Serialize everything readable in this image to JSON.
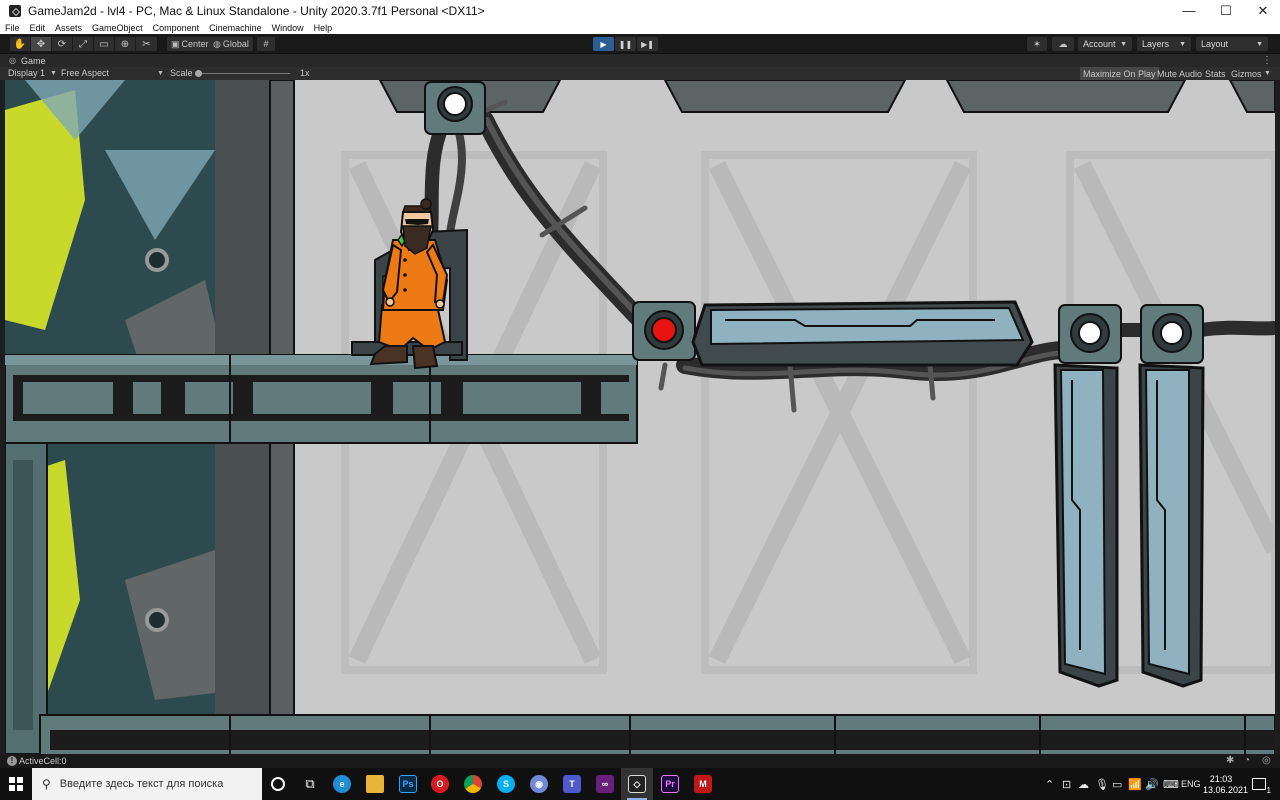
{
  "window": {
    "title": "GameJam2d - lvl4 - PC, Mac & Linux Standalone - Unity 2020.3.7f1 Personal <DX11>",
    "minimize": "—",
    "maximize": "☐",
    "close": "✕"
  },
  "menu": [
    "File",
    "Edit",
    "Assets",
    "GameObject",
    "Component",
    "Cinemachine",
    "Window",
    "Help"
  ],
  "toolbar": {
    "pivot_label": "Center",
    "space_label": "Global",
    "account_label": "Account",
    "layers_label": "Layers",
    "layout_label": "Layout"
  },
  "game_tab": {
    "label": "Game"
  },
  "game_bar": {
    "display": "Display 1",
    "aspect": "Free Aspect",
    "scale_label": "Scale",
    "scale_value": "1x",
    "maximize_on_play": "Maximize On Play",
    "mute_audio": "Mute Audio",
    "stats": "Stats",
    "gizmos": "Gizmos"
  },
  "status": {
    "text": "ActiveCell:0"
  },
  "taskbar": {
    "search_placeholder": "Введите здесь текст для поиска",
    "language": "ENG",
    "time": "21:03",
    "date": "13.06.2021",
    "notification_count": "1"
  }
}
